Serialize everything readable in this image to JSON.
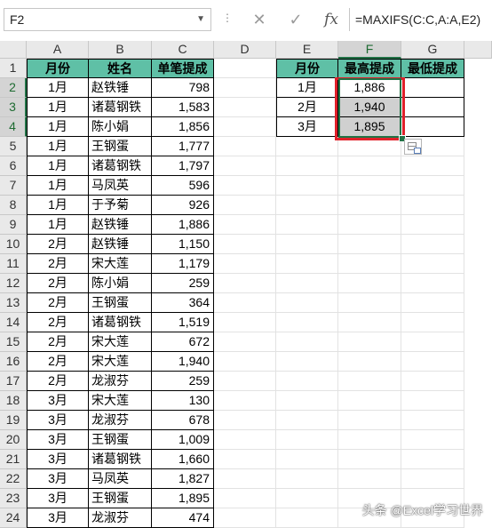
{
  "formula_bar": {
    "name_box": "F2",
    "dots": "⋮",
    "cancel_icon": "✕",
    "enter_icon": "✓",
    "fx_label": "fx",
    "formula": "=MAXIFS(C:C,A:A,E2)"
  },
  "columns": [
    "A",
    "B",
    "C",
    "D",
    "E",
    "F",
    "G"
  ],
  "rows": [
    "1",
    "2",
    "3",
    "4",
    "5",
    "6",
    "7",
    "8",
    "9",
    "10",
    "11",
    "12",
    "13",
    "14",
    "15",
    "16",
    "17",
    "18",
    "19",
    "20",
    "21",
    "22",
    "23",
    "24"
  ],
  "left_table": {
    "headers": [
      "月份",
      "姓名",
      "单笔提成"
    ],
    "rows": [
      [
        "1月",
        "赵铁锤",
        "798"
      ],
      [
        "1月",
        "诸葛钢铁",
        "1,583"
      ],
      [
        "1月",
        "陈小娟",
        "1,856"
      ],
      [
        "1月",
        "王钢蛋",
        "1,777"
      ],
      [
        "1月",
        "诸葛钢铁",
        "1,797"
      ],
      [
        "1月",
        "马凤英",
        "596"
      ],
      [
        "1月",
        "于予菊",
        "926"
      ],
      [
        "1月",
        "赵铁锤",
        "1,886"
      ],
      [
        "2月",
        "赵铁锤",
        "1,150"
      ],
      [
        "2月",
        "宋大莲",
        "1,179"
      ],
      [
        "2月",
        "陈小娟",
        "259"
      ],
      [
        "2月",
        "王钢蛋",
        "364"
      ],
      [
        "2月",
        "诸葛钢铁",
        "1,519"
      ],
      [
        "2月",
        "宋大莲",
        "672"
      ],
      [
        "2月",
        "宋大莲",
        "1,940"
      ],
      [
        "2月",
        "龙淑芬",
        "259"
      ],
      [
        "3月",
        "宋大莲",
        "130"
      ],
      [
        "3月",
        "龙淑芬",
        "678"
      ],
      [
        "3月",
        "王钢蛋",
        "1,009"
      ],
      [
        "3月",
        "诸葛钢铁",
        "1,660"
      ],
      [
        "3月",
        "马凤英",
        "1,827"
      ],
      [
        "3月",
        "王钢蛋",
        "1,895"
      ],
      [
        "3月",
        "龙淑芬",
        "474"
      ]
    ]
  },
  "right_table": {
    "headers": [
      "月份",
      "最高提成",
      "最低提成"
    ],
    "rows": [
      [
        "1月",
        "1,886",
        ""
      ],
      [
        "2月",
        "1,940",
        ""
      ],
      [
        "3月",
        "1,895",
        ""
      ]
    ]
  },
  "selected_column": "F",
  "selected_rows": [
    "2",
    "3",
    "4"
  ],
  "watermark": "头条 @Excel学习世界",
  "colors": {
    "header_fill": "#5fc0a6",
    "selection_border": "#e0202a",
    "excel_green": "#217346"
  }
}
